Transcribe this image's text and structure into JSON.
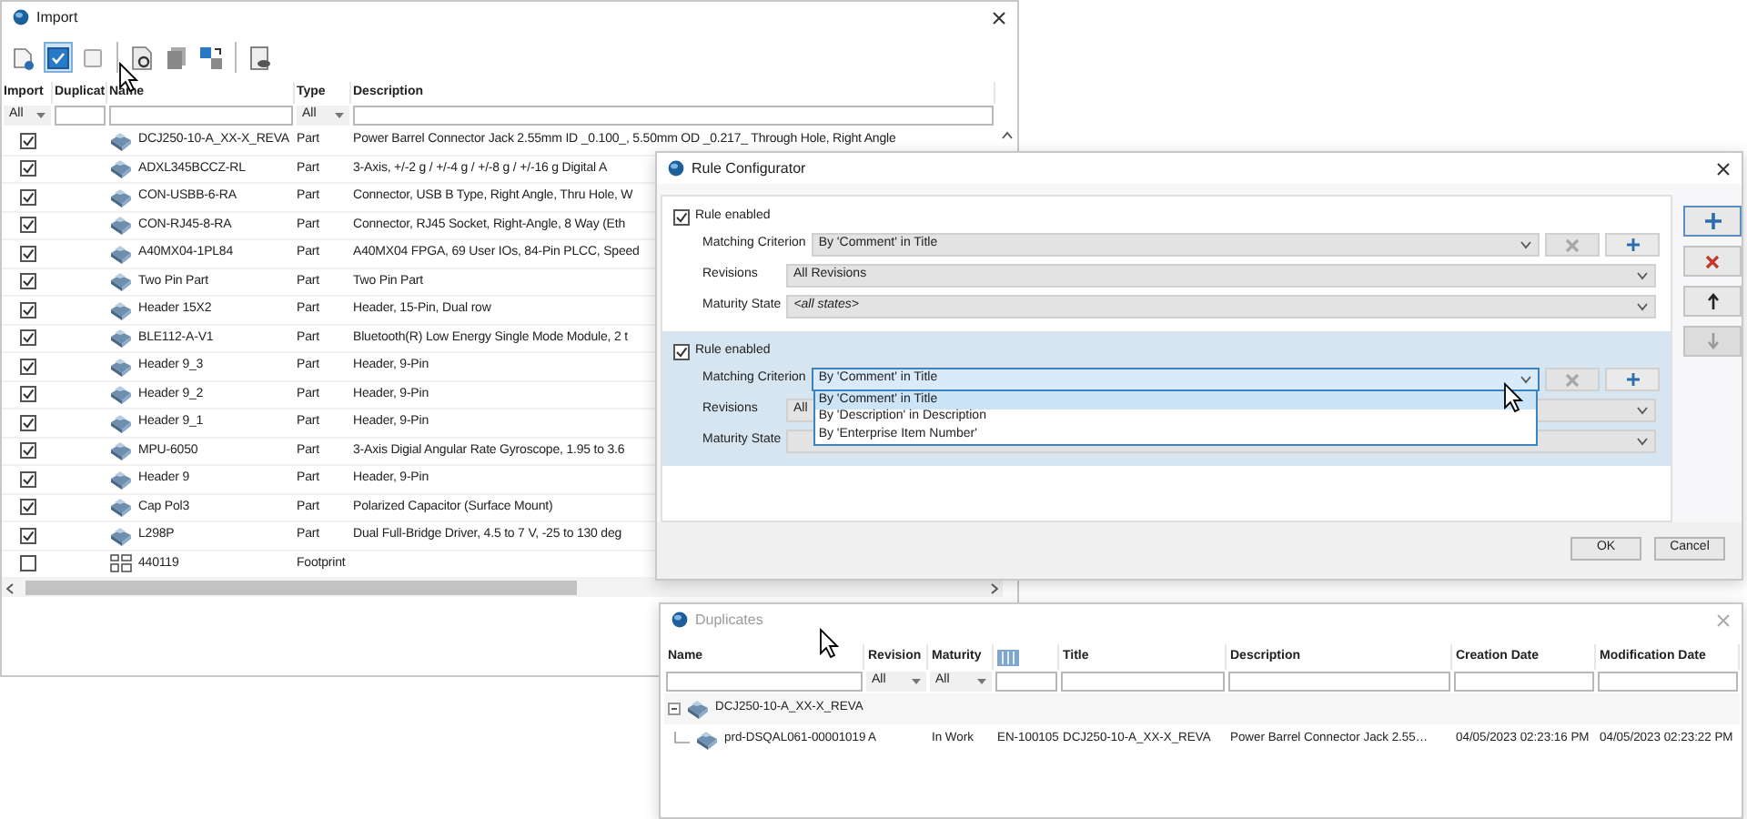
{
  "import_window": {
    "title": "Import",
    "toolbar": [
      [
        {
          "kind": "new",
          "selected": false
        },
        {
          "kind": "check-all",
          "selected": true
        },
        {
          "kind": "uncheck-all",
          "selected": false
        }
      ],
      [
        {
          "kind": "import",
          "selected": false
        },
        {
          "kind": "copy",
          "selected": false
        },
        {
          "kind": "swap",
          "selected": false
        }
      ],
      [
        {
          "kind": "preview",
          "selected": false
        }
      ]
    ],
    "columns": [
      "Import",
      "Duplicat",
      "Name",
      "Type",
      "Description"
    ],
    "filters": [
      {
        "kind": "select",
        "value": "All"
      },
      {
        "kind": "text"
      },
      {
        "kind": "text"
      },
      {
        "kind": "select",
        "value": "All"
      },
      {
        "kind": "text"
      }
    ],
    "rows": [
      {
        "checked": true,
        "kind": "part",
        "name": "DCJ250-10-A_XX-X_REVA",
        "type": "Part",
        "description": "Power Barrel Connector Jack 2.55mm ID _0.100_, 5.50mm OD _0.217_ Through Hole, Right Angle"
      },
      {
        "checked": true,
        "kind": "part",
        "name": "ADXL345BCCZ-RL",
        "type": "Part",
        "description": "3-Axis, +/-2 g / +/-4 g / +/-8 g / +/-16 g Digital A"
      },
      {
        "checked": true,
        "kind": "part",
        "name": "CON-USBB-6-RA",
        "type": "Part",
        "description": "Connector, USB B Type, Right Angle, Thru Hole, W"
      },
      {
        "checked": true,
        "kind": "part",
        "name": "CON-RJ45-8-RA",
        "type": "Part",
        "description": "Connector, RJ45 Socket, Right-Angle, 8 Way (Eth"
      },
      {
        "checked": true,
        "kind": "part",
        "name": "A40MX04-1PL84",
        "type": "Part",
        "description": "A40MX04 FPGA, 69 User IOs, 84-Pin PLCC, Speed"
      },
      {
        "checked": true,
        "kind": "part",
        "name": "Two Pin Part",
        "type": "Part",
        "description": "Two Pin Part"
      },
      {
        "checked": true,
        "kind": "part",
        "name": "Header 15X2",
        "type": "Part",
        "description": "Header, 15-Pin, Dual row"
      },
      {
        "checked": true,
        "kind": "part",
        "name": "BLE112-A-V1",
        "type": "Part",
        "description": "Bluetooth(R) Low Energy Single Mode Module, 2 t"
      },
      {
        "checked": true,
        "kind": "part",
        "name": "Header 9_3",
        "type": "Part",
        "description": "Header, 9-Pin"
      },
      {
        "checked": true,
        "kind": "part",
        "name": "Header 9_2",
        "type": "Part",
        "description": "Header, 9-Pin"
      },
      {
        "checked": true,
        "kind": "part",
        "name": "Header 9_1",
        "type": "Part",
        "description": "Header, 9-Pin"
      },
      {
        "checked": true,
        "kind": "part",
        "name": "MPU-6050",
        "type": "Part",
        "description": "3-Axis Digial Angular Rate Gyroscope, 1.95 to 3.6"
      },
      {
        "checked": true,
        "kind": "part",
        "name": "Header 9",
        "type": "Part",
        "description": "Header, 9-Pin"
      },
      {
        "checked": true,
        "kind": "part",
        "name": "Cap Pol3",
        "type": "Part",
        "description": "Polarized Capacitor (Surface Mount)"
      },
      {
        "checked": true,
        "kind": "part",
        "name": "L298P",
        "type": "Part",
        "description": "Dual Full-Bridge Driver, 4.5 to 7 V, -25 to 130 deg"
      },
      {
        "checked": false,
        "kind": "footprint",
        "name": "440119",
        "type": "Footprint"
      }
    ]
  },
  "rule_configurator": {
    "title": "Rule Configurator",
    "rules": [
      {
        "enabled": true,
        "selected": false,
        "enabled_label": "Rule enabled",
        "criterion_label": "Matching Criterion",
        "criterion": "By 'Comment' in Title",
        "revisions_label": "Revisions",
        "revisions": "All Revisions",
        "maturity_label": "Maturity State",
        "maturity": "<all states>"
      },
      {
        "enabled": true,
        "selected": true,
        "enabled_label": "Rule enabled",
        "criterion_label": "Matching Criterion",
        "criterion": "By 'Comment' in Title",
        "revisions_label": "Revisions",
        "revisions": "All",
        "maturity_label": "Maturity State",
        "dropdown": [
          {
            "label": "By 'Comment' in Title",
            "selected": true
          },
          {
            "label": "By 'Description' in Description",
            "selected": false
          },
          {
            "label": "By 'Enterprise Item Number'",
            "selected": false
          }
        ]
      }
    ],
    "side_buttons": [
      {
        "kind": "add",
        "disabled": false
      },
      {
        "kind": "delete",
        "disabled": false
      },
      {
        "kind": "up",
        "disabled": false
      },
      {
        "kind": "down",
        "disabled": true
      }
    ],
    "buttons": [
      "OK",
      "Cancel"
    ]
  },
  "duplicates_window": {
    "title": "Duplicates",
    "columns": [
      {
        "kind": "text",
        "label": "Name"
      },
      {
        "kind": "text",
        "label": "Revision"
      },
      {
        "kind": "text",
        "label": "Maturity"
      },
      {
        "kind": "icon"
      },
      {
        "kind": "text",
        "label": "Title"
      },
      {
        "kind": "text",
        "label": "Description"
      },
      {
        "kind": "text",
        "label": "Creation Date"
      },
      {
        "kind": "text",
        "label": "Modification Date"
      }
    ],
    "filters": [
      {
        "kind": "text"
      },
      {
        "kind": "select",
        "value": "All"
      },
      {
        "kind": "select",
        "value": "All"
      },
      {
        "kind": "text"
      },
      {
        "kind": "text"
      },
      {
        "kind": "text"
      },
      {
        "kind": "text"
      },
      {
        "kind": "text"
      }
    ],
    "tree": [
      {
        "name": "DCJ250-10-A_XX-X_REVA",
        "expanded": true,
        "children": [
          {
            "name": "prd-DSQAL061-00001019",
            "revision": "A",
            "maturity": "In Work",
            "number": "EN-100105",
            "title": "DCJ250-10-A_XX-X_REVA",
            "description": "Power Barrel Connector Jack 2.55…",
            "created": "04/05/2023 02:23:16 PM",
            "modified": "04/05/2023 02:23:22 PM"
          }
        ]
      }
    ]
  }
}
